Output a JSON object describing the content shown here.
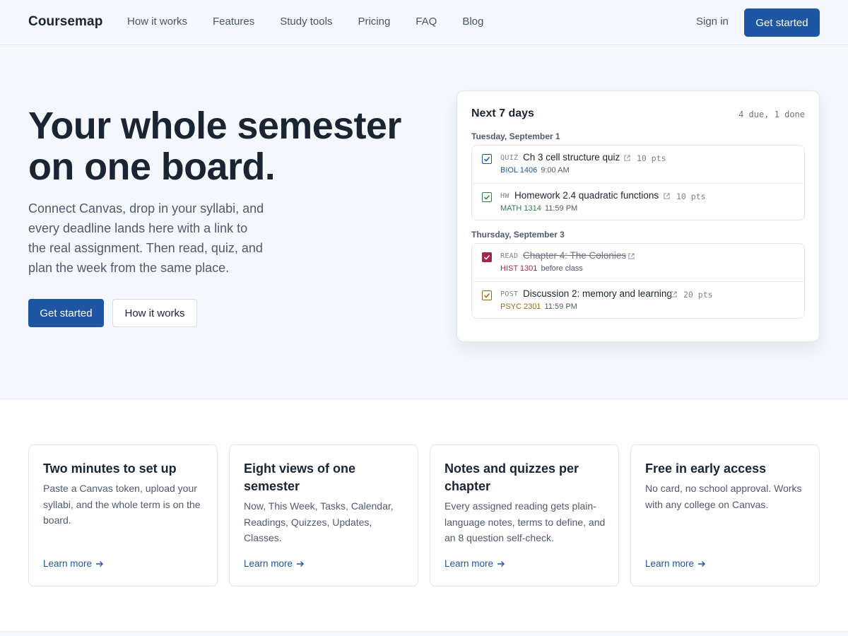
{
  "nav": {
    "brand": "Coursemap",
    "links": [
      "How it works",
      "Features",
      "Study tools",
      "Pricing",
      "FAQ",
      "Blog"
    ],
    "sign_in": "Sign in",
    "cta": "Get started"
  },
  "hero": {
    "title_line1": "Your whole semester",
    "title_line2": "on one board.",
    "subtitle": "Connect Canvas, drop in your syllabi, and every deadline lands here with a link to the real assignment. Then read, quiz, and plan the week from the same place.",
    "primary_cta": "Get started",
    "secondary_cta": "How it works"
  },
  "board": {
    "title": "Next 7 days",
    "meta": "4 due, 1 done",
    "days": [
      {
        "label": "Tuesday, September 1",
        "items": [
          {
            "kind": "QUIZ",
            "title": "Ch 3 cell structure quiz",
            "pts": "10 pts",
            "course": "BIOL 1406",
            "time": "9:00 AM",
            "done": false
          },
          {
            "kind": "HW",
            "title": "Homework 2.4 quadratic functions",
            "pts": "10 pts",
            "course": "MATH 1314",
            "time": "11:59 PM",
            "done": false
          }
        ]
      },
      {
        "label": "Thursday, September 3",
        "items": [
          {
            "kind": "READ",
            "title": "Chapter 4: The Colonies",
            "pts": "",
            "course": "HIST 1301",
            "time": "before class",
            "done": true
          },
          {
            "kind": "POST",
            "title": "Discussion 2: memory and learning",
            "pts": "20 pts",
            "course": "PSYC 2301",
            "time": "11:59 PM",
            "done": false
          }
        ]
      }
    ],
    "colors": {
      "biol": "#1f56a3",
      "math": "#2e7d46",
      "hist": "#a3264d",
      "psyc": "#9a6b12"
    }
  },
  "features": [
    {
      "title": "Two minutes to set up",
      "body": "Paste a Canvas token, upload your syllabi, and the whole term is on the board.",
      "link": "Learn more"
    },
    {
      "title": "Eight views of one semester",
      "body": "Now, This Week, Tasks, Calendar, Readings, Quizzes, Updates, Classes.",
      "link": "Learn more"
    },
    {
      "title": "Notes and quizzes per chapter",
      "body": "Every assigned reading gets plain-language notes, terms to define, and an 8 question self-check.",
      "link": "Learn more"
    },
    {
      "title": "Free in early access",
      "body": "No card, no school approval. Works with any college on Canvas.",
      "link": "Learn more"
    }
  ],
  "colors": {
    "accent": "#1f56a3",
    "hero_bg": "#f4f7fb"
  }
}
